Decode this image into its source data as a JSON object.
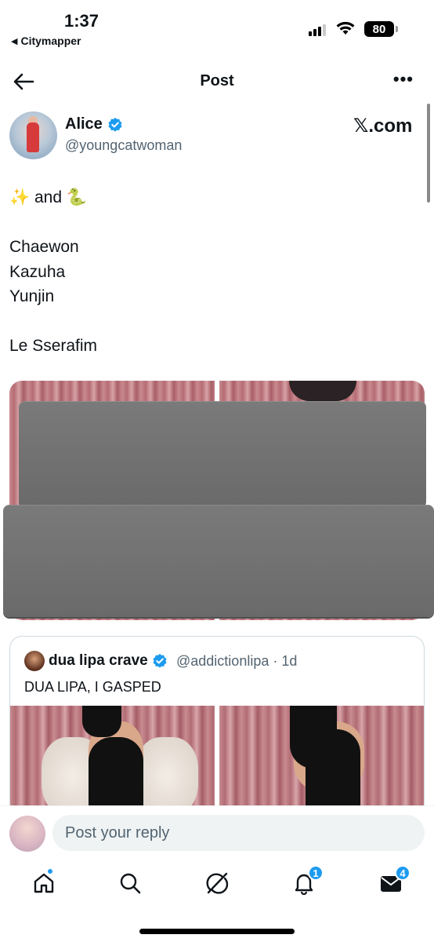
{
  "status_bar": {
    "time": "1:37",
    "back_app": "Citymapper",
    "battery": "80"
  },
  "header": {
    "title": "Post",
    "back_icon": "back-arrow-icon",
    "more_icon": "more-icon"
  },
  "post": {
    "author_name": "Alice",
    "author_handle": "@youngcatwoman",
    "source_logo": "𝕏.com",
    "text": "✨ and 🐍\n\nChaewon\nKazuha\nYunjin\n\nLe Sserafim"
  },
  "quote": {
    "author_name": "dua lipa crave",
    "author_handle": "@addictionlipa · 1d",
    "text": "DUA LIPA, I GASPED"
  },
  "reply": {
    "placeholder": "Post your reply"
  },
  "tabs": [
    {
      "icon": "home-icon",
      "indicator": "dot"
    },
    {
      "icon": "search-icon"
    },
    {
      "icon": "grok-icon"
    },
    {
      "icon": "notifications-icon",
      "badge": "1"
    },
    {
      "icon": "messages-icon",
      "badge": "4"
    }
  ],
  "colors": {
    "accent": "#1d9bf0",
    "text": "#0f1419",
    "secondary": "#536471",
    "redaction": "#6e6e6e"
  }
}
